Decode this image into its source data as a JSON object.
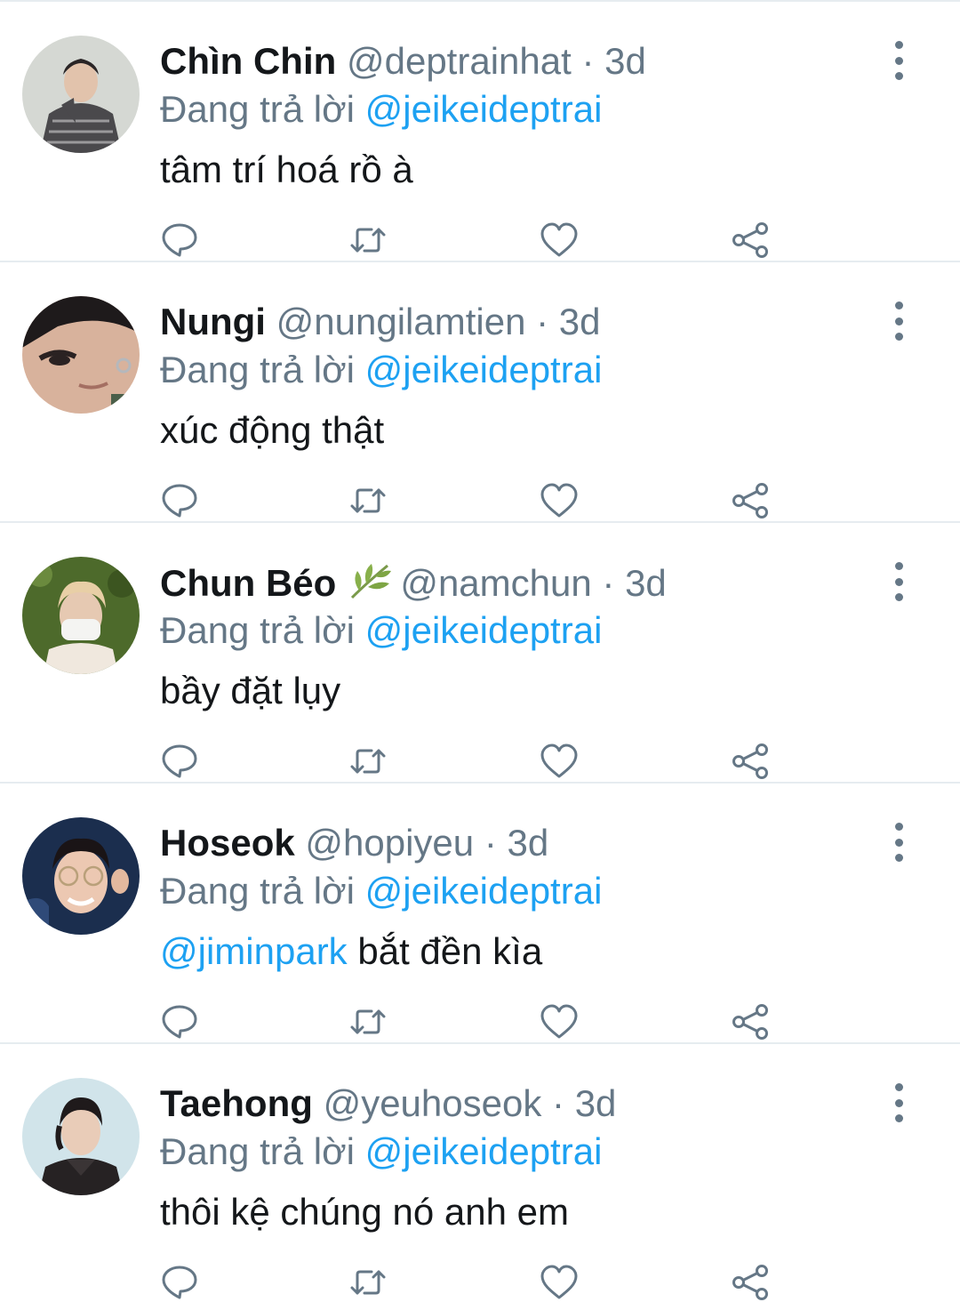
{
  "tweets": [
    {
      "name": "Chìn Chin",
      "handle": "@deptrainhat",
      "separator": "·",
      "time": "3d",
      "reply_prefix": "Đang trả lời",
      "reply_to": "@jeikeideptrai",
      "mention": "",
      "text": "tâm trí hoá rồ à",
      "avatar_colors": [
        "#cfd3cc",
        "#3e3d3f"
      ]
    },
    {
      "name": "Nungi",
      "handle": "@nungilamtien",
      "separator": "·",
      "time": "3d",
      "reply_prefix": "Đang trả lời",
      "reply_to": "@jeikeideptrai",
      "mention": "",
      "text": "xúc động thật",
      "avatar_colors": [
        "#d9b09a",
        "#1f1b1c"
      ]
    },
    {
      "name": "Chun Béo",
      "name_emoji": "herb-emoji",
      "handle": "@namchun",
      "separator": "·",
      "time": "3d",
      "reply_prefix": "Đang trả lời",
      "reply_to": "@jeikeideptrai",
      "mention": "",
      "text": "bầy đặt lụy",
      "avatar_colors": [
        "#4f6a2c",
        "#efe6dc"
      ]
    },
    {
      "name": "Hoseok",
      "handle": "@hopiyeu",
      "separator": "·",
      "time": "3d",
      "reply_prefix": "Đang trả lời",
      "reply_to": "@jeikeideptrai",
      "mention": "@jiminpark",
      "text": " bắt đền kìa",
      "avatar_colors": [
        "#1c2f4f",
        "#e8c3ae"
      ]
    },
    {
      "name": "Taehong",
      "handle": "@yeuhoseok",
      "separator": "·",
      "time": "3d",
      "reply_prefix": "Đang trả lời",
      "reply_to": "@jeikeideptrai",
      "mention": "",
      "text": "thôi kệ chúng nó anh em",
      "avatar_colors": [
        "#cfe3ea",
        "#2a2626"
      ]
    }
  ],
  "icons": {
    "reply": "reply-icon",
    "retweet": "retweet-icon",
    "like": "like-icon",
    "share": "share-icon",
    "more": "more-icon"
  },
  "colors": {
    "primary_text": "#14171a",
    "secondary_text": "#657786",
    "accent": "#1da1f2",
    "divider": "#e6ecf0"
  }
}
